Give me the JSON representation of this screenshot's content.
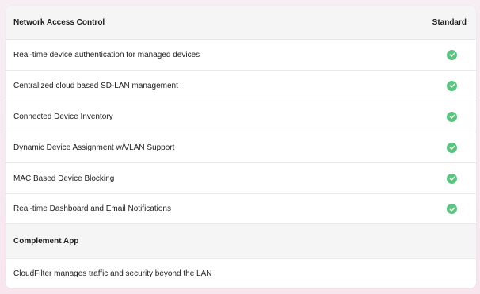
{
  "table": {
    "section_title": "Network Access Control",
    "column_label": "Standard",
    "features": [
      "Real-time device authentication for managed devices",
      "Centralized cloud based SD-LAN management",
      "Connected Device Inventory",
      "Dynamic Device Assignment w/VLAN Support",
      "MAC Based Device Blocking",
      "Real-time Dashboard and Email Notifications"
    ],
    "complement_title": "Complement App",
    "complement_item": "CloudFilter manages traffic and security beyond the LAN",
    "check_icon": "check-circle-icon",
    "check_color": "#5cc481"
  }
}
